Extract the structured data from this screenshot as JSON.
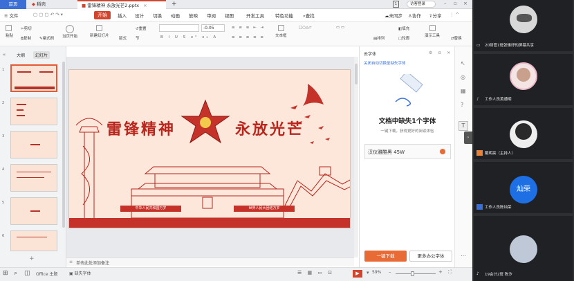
{
  "tabs": {
    "home": "首页",
    "docer": "稻壳",
    "doc": "雷锋精神  永放光芒2.pptx",
    "add": "+"
  },
  "titlebar": {
    "badge": "1",
    "visitor_login": "访客登录"
  },
  "menu": {
    "file": "≡ 文件",
    "items": [
      "开始",
      "插入",
      "设计",
      "切换",
      "动画",
      "放映",
      "审阅",
      "视图",
      "开发工具",
      "特色功能"
    ],
    "search": "查找",
    "unsync": "未同步",
    "collab": "协作",
    "share": "分享"
  },
  "ribbon": {
    "cut": "剪切",
    "copy": "复制",
    "format_painter": "格式刷",
    "paste": "粘贴",
    "from_current": "当页开始",
    "new_slide": "新建幻灯片",
    "layout": "版式",
    "section": "节",
    "reset": "重置",
    "font_size": "-0.05",
    "arrange": "排列",
    "fill": "填充",
    "outline": "轮廓",
    "textbox": "文本框",
    "demo_tools": "演示工具",
    "replace": "替换"
  },
  "panel": {
    "outline": "大纲",
    "slides": "幻灯片",
    "add": "+",
    "thumbs": [
      "1",
      "2",
      "3",
      "4",
      "5",
      "6"
    ]
  },
  "slide": {
    "title_left": "雷锋精神",
    "title_right": "永放光芒",
    "banner_left": "中华人民共和国万岁",
    "banner_right": "世界人民大团结万岁"
  },
  "notes": {
    "placeholder": "单击此处添加备注"
  },
  "status": {
    "theme": "Office 主题",
    "missing_font": "缺失字体",
    "zoom": "59%"
  },
  "fontpanel": {
    "title": "云字体",
    "link": "关闭自动切换至缺失字体",
    "headline": "文档中缺失1个字体",
    "sub": "一键下载，获得更好的阅读体验",
    "font_name": "汉仪雅酷黑 45W",
    "download": "一键下载",
    "more": "更多办公字体"
  },
  "video": {
    "tiles": [
      {
        "name": "20财管1班张愫妤的屏幕共享"
      },
      {
        "name": "工作人员黄通明"
      },
      {
        "name": "戴明亮（主持人）"
      },
      {
        "name": "工作人员陈灿荣",
        "avatar_text": "灿荣"
      },
      {
        "name": "19会计2班 陈汐"
      }
    ]
  },
  "colors": {
    "accent": "#d0452d",
    "slide_red": "#b8261d",
    "blue": "#3b6fd6"
  }
}
